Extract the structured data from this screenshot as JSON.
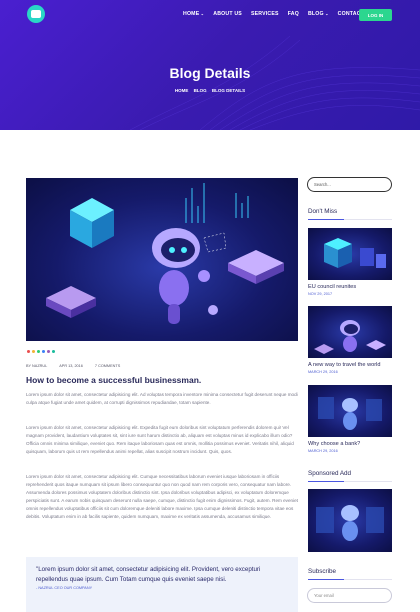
{
  "header": {
    "logo_icon": "robot-icon",
    "nav": [
      {
        "label": "HOME",
        "dropdown": true
      },
      {
        "label": "ABOUT US",
        "dropdown": false
      },
      {
        "label": "SERVICES",
        "dropdown": false
      },
      {
        "label": "FAQ",
        "dropdown": false
      },
      {
        "label": "BLOG",
        "dropdown": true
      },
      {
        "label": "CONTACT",
        "dropdown": false
      }
    ],
    "login_label": "LOG IN",
    "page_title": "Blog Details",
    "breadcrumbs": [
      "HOME",
      "BLOG",
      "BLOG DETAILS"
    ]
  },
  "colors": {
    "hero": "#3a1bb0",
    "accent": "#2cd68f",
    "link": "#4a5ad0"
  },
  "post": {
    "image_dot_colors": [
      "#e94e4e",
      "#f2b233",
      "#2ecc71",
      "#3b82f6",
      "#9b59b6",
      "#1abc9c"
    ],
    "author": "BY NAZRUL",
    "date": "APR 13, 2016",
    "comments": "7 COMMENTS",
    "title": "How to become a successful businessman.",
    "paragraphs": [
      "Lorem ipsum dolor sit amet, consectetur adipisicing elit. Ad voluptas tempora inventore minima consectetur fugit deserunt neque modi culpa atque fugiat unde amet quidem, at corrupti dignissimos repudiandae, totam sapiente.",
      "Lorem ipsum dolor sit amet, consectetur adipisicing elit. Expedita fugit eum doloribus sint voluptatum perferendis dolorem qui! Vel magnam provident, laudantium voluptates sit, sint iure sunt harum distinctio ab, aliquam est voluptas minus id explicabo illum odio? Officia omnis minima similique, eveniet quo. Rem itaque laboriosam quas est omnis, mollitia possimus eveniet. Veritatis nihil, aliquid quisquam, laborum quis ut rem repellendus animi repellat, alias suscipit nostrum incidunt. Quis, quos.",
      "Lorem ipsum dolor sit amet, consectetur adipisicing elit. Cumque necessitatibus laborum eveniet iusque laboriosam in officiis reprehenderit quos itaque numquam sit ipsum libero consequuntur quo non quod nam rem corporis vero, consequatur nam labore. Assumenda dolores possimus voluptatem doloribus distinctio sint. Ipsa doloribus voluptatibus adipisci, ex voluptatum doloremque perspiciatis sunt. A earum nobis quisquam deserunt nulla saepe, cumque, distinctio fugit enim dignissimos. Fugit, autem. Rem eveniet omnis repellendus voluptatibus officiis sit cum doloremque deleniti labore maxime. Ipsa cumque deleniti distinctio tempora vitae eos debitis. Voluptatum enim in ab facilis sapiente, quidem numquam, maxime ex veritatis assumenda, accusamus similique."
    ],
    "quote": "\"Lorem ipsum dolor sit amet, consectetur adipisicing elit. Provident, vero excepturi repellendus quae ipsum. Cum Totam cumque quis eveniet saepe nisi.",
    "quote_author": "- NAZRUL CEO OUR COMPANY"
  },
  "sidebar": {
    "search_placeholder": "Search...",
    "dont_miss_title": "Don't Miss",
    "articles": [
      {
        "title": "EU council reunites",
        "date": "NOV 29, 2017"
      },
      {
        "title": "A new way to travel the world",
        "date": "MARCH 29, 2016"
      },
      {
        "title": "Why choose a bank?",
        "date": "MARCH 29, 2016"
      }
    ],
    "sponsored_title": "Sponsored Add",
    "subscribe_title": "Subscribe",
    "email_placeholder": "Your email"
  }
}
